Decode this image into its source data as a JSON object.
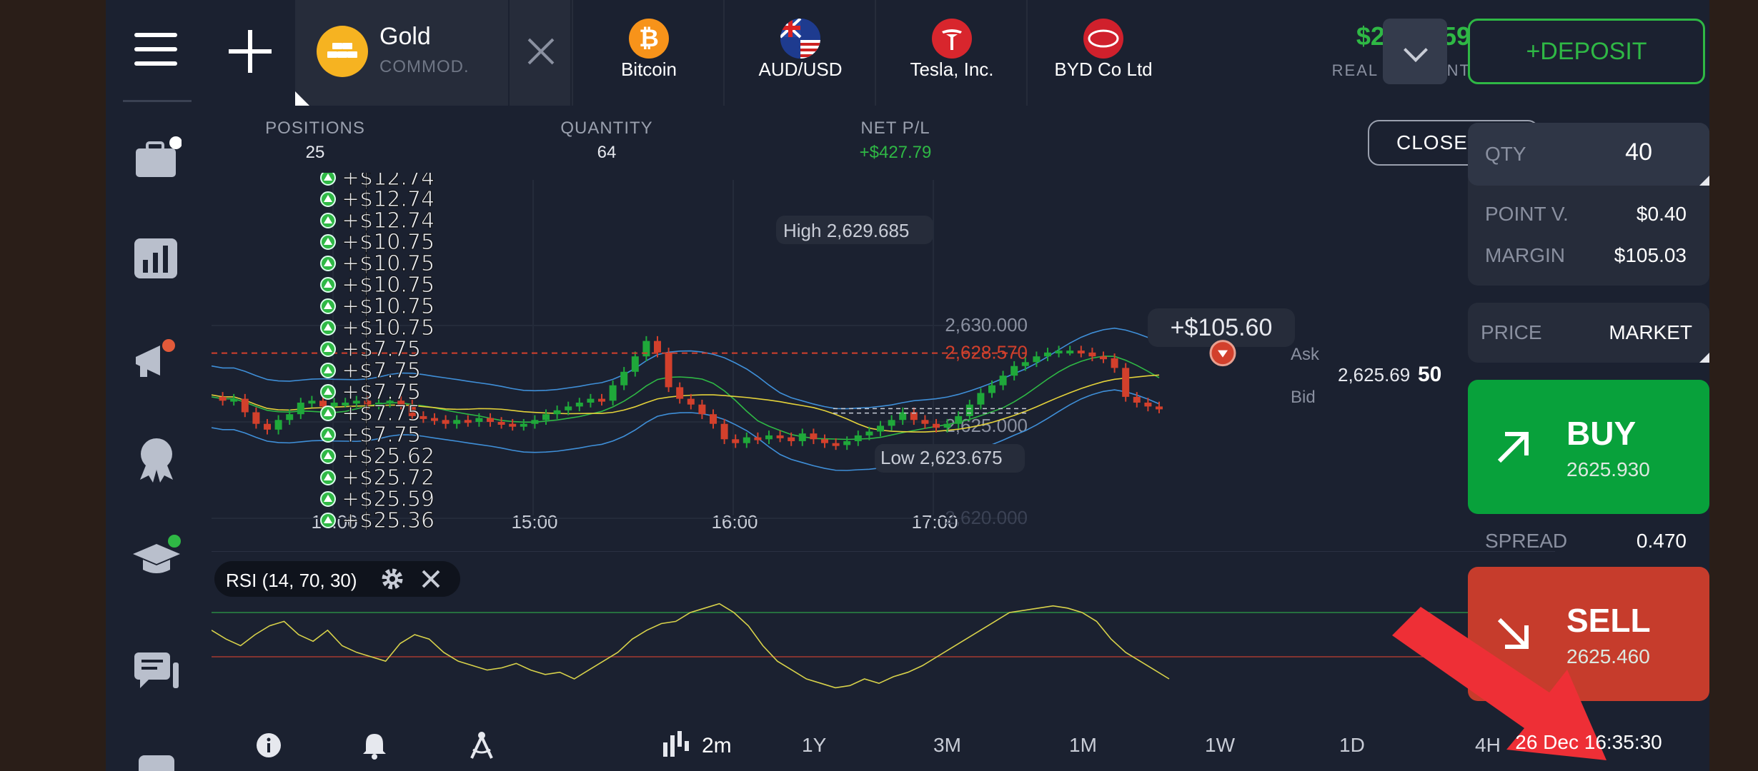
{
  "topbar": {
    "active_tab": {
      "title": "Gold",
      "subtitle": "COMMOD."
    },
    "tabs": [
      {
        "label": "Bitcoin",
        "icon": "bitcoin-icon",
        "color": "#f7931a"
      },
      {
        "label": "AUD/USD",
        "icon": "australia-flag-icon",
        "color": "#1e3b8f"
      },
      {
        "label": "Tesla, Inc.",
        "icon": "tesla-icon",
        "color": "#d8262d"
      },
      {
        "label": "BYD Co Ltd",
        "icon": "byd-icon",
        "color": "#d0202c"
      }
    ],
    "balance": "$2,259.59",
    "account_label": "REAL ACCOUNT",
    "deposit_label": "+DEPOSIT"
  },
  "positions": {
    "positions_label": "POSITIONS",
    "positions_value": "25",
    "quantity_label": "QUANTITY",
    "quantity_value": "64",
    "netpl_label": "NET P/L",
    "netpl_value": "+$427.79",
    "close_all_label": "CLOSE ALL"
  },
  "chart": {
    "high_label": "High 2,629.685",
    "low_label": "Low 2,623.675",
    "profit_badge": "+$105.60",
    "price_levels": [
      "2,630.000",
      "2,628.570",
      "2,625.000",
      "2,620.000"
    ],
    "current_price_main": "2,625.69",
    "current_price_bold": "50",
    "ask_label": "Ask",
    "bid_label": "Bid",
    "time_labels": [
      "14:00",
      "15:00",
      "16:00",
      "17:00"
    ],
    "trade_pl_list": [
      "+$12.74",
      "+$12.74",
      "+$12.74",
      "+$10.75",
      "+$10.75",
      "+$10.75",
      "+$10.75",
      "+$10.75",
      "+$7.75",
      "+$7.75",
      "+$7.75",
      "+$7.75",
      "+$7.75",
      "+$25.62",
      "+$25.72",
      "+$25.59",
      "+$25.36"
    ]
  },
  "rsi": {
    "label": "RSI (14, 70, 30)",
    "level_high": "70%",
    "level_low": "30%"
  },
  "bottom": {
    "interval": "2m",
    "ranges": [
      "1Y",
      "3M",
      "1M",
      "1W",
      "1D",
      "4H"
    ]
  },
  "panel": {
    "qty_label": "QTY",
    "qty_value": "40",
    "point_label": "POINT V.",
    "point_value": "$0.40",
    "margin_label": "MARGIN",
    "margin_value": "$105.03",
    "price_label": "PRICE",
    "price_value": "MARKET",
    "buy_label": "BUY",
    "buy_price": "2625.930",
    "spread_label": "SPREAD",
    "spread_value": "0.470",
    "sell_label": "SELL",
    "sell_price": "2625.460",
    "datetime": "26 Dec 16:35:30"
  },
  "colors": {
    "up": "#1fa83a",
    "down": "#d2402c",
    "accent": "#2fb845",
    "sell": "#c63c2c",
    "buy": "#08a13b"
  }
}
